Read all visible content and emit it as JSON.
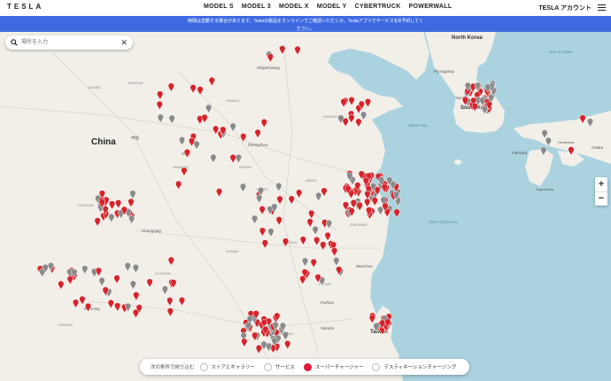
{
  "nav": {
    "logo": "TESLA",
    "links": [
      "MODEL S",
      "MODEL 3",
      "MODEL X",
      "MODEL Y",
      "CYBERTRUCK",
      "POWERWALL"
    ],
    "account": "TESLA アカウント"
  },
  "banner": {
    "line1": "時間は変動する場合があります。Teslaの製品をオンラインでご確認いただくか、TeslaアプリでサービスをÐ予約してく",
    "line2": "ださい。"
  },
  "search": {
    "placeholder": "場所を入力"
  },
  "zoom": {
    "plus": "+",
    "minus": "−"
  },
  "filter": {
    "label": "次の条件で絞り込む",
    "options": [
      {
        "label": "ストアとギャラリー",
        "checked": false
      },
      {
        "label": "サービス",
        "checked": false
      },
      {
        "label": "スーパーチャージャー",
        "checked": true
      },
      {
        "label": "デスティネーションチャージング",
        "checked": false
      }
    ]
  },
  "map": {
    "labels": {
      "china": "China",
      "china_native": "中国",
      "north_korea": "North Korea",
      "pyongyang": "Pyongyang",
      "seoul": "Seoul",
      "south_korea": "South Korea",
      "yellow_sea": "Yellow Sea",
      "east_china_sea": "East China Sea",
      "sea_of_japan": "Sea of Japan",
      "fukuoka": "Fukuoka",
      "osaka": "Osaka",
      "hiroshima": "Hiroshima",
      "kagoshima": "Kagoshima",
      "taiwan": "Taiwan",
      "wenzhou": "Wenzhou",
      "fuzhou": "Fuzhou",
      "xiamen": "Xiamen",
      "chongqing": "Chongqing",
      "kunming": "Kunming",
      "zhengzhou": "Zhengzhou",
      "xi_an": "Xi'an",
      "shijiazhuang": "Shijiazhuang",
      "guangzhou": "Guangzhou",
      "shandong": "SHANDONG",
      "hubei": "HUBEI",
      "hunan": "HUNAN",
      "guizhou": "GUIZHOU",
      "yunnan": "YUNNAN",
      "sichuan": "SICHUAN",
      "gansu": "GANSU",
      "ningxia": "NINGXIA",
      "shaanxi": "SHAANXI",
      "henan": "HENAN",
      "anhui": "ANHUI",
      "jiangxi": "JIANGXI",
      "fujian": "FUJIAN",
      "guangdong": "GUANGDONG",
      "zhejiang": "ZHEJIANG",
      "shanxi": "SHANXI"
    },
    "colors": {
      "land": "#f2efe9",
      "water": "#aad3df",
      "supercharger": "#d8232a",
      "other_pin": "#8a8a8a"
    }
  }
}
